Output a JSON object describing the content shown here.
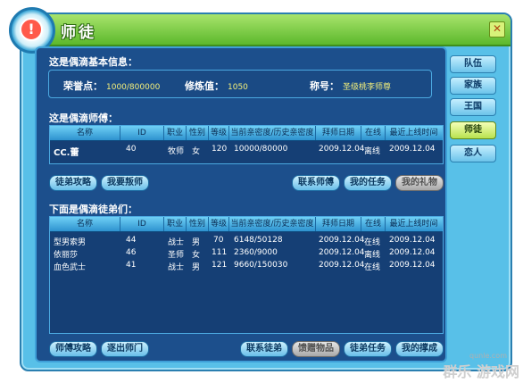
{
  "window": {
    "title": "师徒",
    "badge_glyph": "!",
    "close_glyph": "✕"
  },
  "side_tabs": [
    {
      "label": "队伍",
      "active": false
    },
    {
      "label": "家族",
      "active": false
    },
    {
      "label": "王国",
      "active": false
    },
    {
      "label": "师徒",
      "active": true
    },
    {
      "label": "恋人",
      "active": false
    }
  ],
  "basic_info": {
    "heading": "这是偶滴基本信息：",
    "honor_label": "荣誉点：",
    "honor_value": "1000/800000",
    "cultivation_label": "修炼值：",
    "cultivation_value": "1050",
    "title_label": "称号：",
    "title_value": "圣级桃李师尊"
  },
  "master_section": {
    "heading": "这是偶滴师傅：",
    "columns": [
      "名称",
      "ID",
      "职业",
      "性别",
      "等级",
      "当前亲密度/历史亲密度",
      "拜师日期",
      "在线",
      "最近上线时间"
    ],
    "rows": [
      {
        "name": "CC.蕾",
        "id": "40",
        "job": "牧师",
        "gender": "女",
        "level": "120",
        "intimacy": "10000/80000",
        "date": "2009.12.04",
        "online": "离线",
        "last": "2009.12.04"
      }
    ],
    "buttons": {
      "guide": "徒弟攻略",
      "betray": "我要叛师",
      "contact": "联系师傅",
      "tasks": "我的任务",
      "gifts": "我的礼物"
    }
  },
  "disciple_section": {
    "heading": "下面是偶滴徒弟们：",
    "columns": [
      "名称",
      "ID",
      "职业",
      "性别",
      "等级",
      "当前亲密度/历史亲密度",
      "拜师日期",
      "在线",
      "最近上线时间"
    ],
    "rows": [
      {
        "name": "型男索男",
        "id": "44",
        "job": "战士",
        "gender": "男",
        "level": "70",
        "intimacy": "6148/50128",
        "date": "2009.12.04",
        "online": "在线",
        "last": "2009.12.04"
      },
      {
        "name": "依丽莎",
        "id": "46",
        "job": "圣师",
        "gender": "女",
        "level": "111",
        "intimacy": "2360/9000",
        "date": "2009.12.04",
        "online": "离线",
        "last": "2009.12.04"
      },
      {
        "name": "血色武士",
        "id": "41",
        "job": "战士",
        "gender": "男",
        "level": "121",
        "intimacy": "9660/150030",
        "date": "2009.12.04",
        "online": "在线",
        "last": "2009.12.04"
      }
    ],
    "buttons": {
      "guide": "师傅攻略",
      "leave": "逐出师门",
      "contact": "联系徒弟",
      "gift": "馈赠物品",
      "tasks": "徒弟任务",
      "achievements": "我的撑成"
    }
  },
  "watermark": {
    "main": "群乐 游戏网",
    "site": "qunle.com"
  }
}
